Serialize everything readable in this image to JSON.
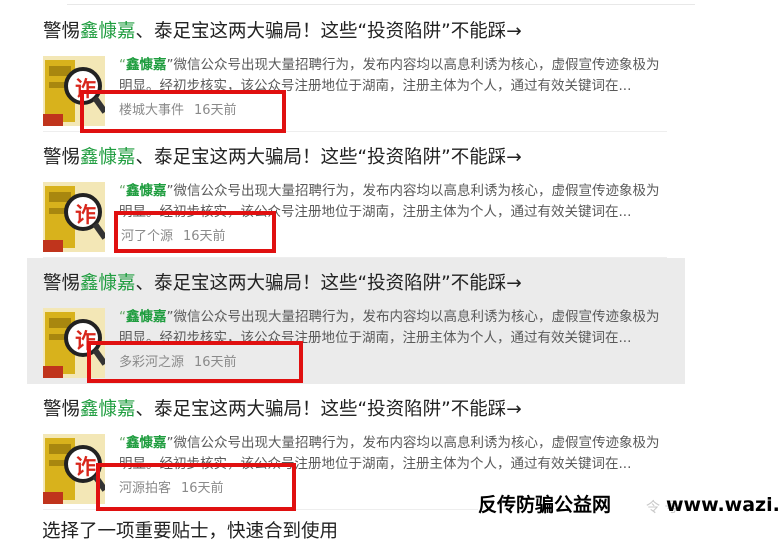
{
  "articles": [
    {
      "title_prefix": "警惕",
      "title_keyword": "鑫慷嘉",
      "title_suffix": "、泰足宝这两大骗局！这些“投资陷阱”不能踩→",
      "snippet_open_quote": "“",
      "snippet_keyword": "鑫慷嘉",
      "snippet_rest": "”微信公众号出现大量招聘行为，发布内容均以高息利诱为核心，虚假宣传迹象极为明显。经初步核实，该公众号注册地位于湖南，注册主体为个人，通过有效关键词在...",
      "source": "楼城大事件",
      "time": "16天前",
      "thumb_icon": "fraud-warning-icon",
      "thumb_glyph": "诈"
    },
    {
      "title_prefix": "警惕",
      "title_keyword": "鑫慷嘉",
      "title_suffix": "、泰足宝这两大骗局！这些“投资陷阱”不能踩→",
      "snippet_open_quote": "“",
      "snippet_keyword": "鑫慷嘉",
      "snippet_rest": "”微信公众号出现大量招聘行为，发布内容均以高息利诱为核心，虚假宣传迹象极为明显。经初步核实，该公众号注册地位于湖南，注册主体为个人，通过有效关键词在...",
      "source": "河了个源",
      "time": "16天前",
      "thumb_icon": "fraud-warning-icon",
      "thumb_glyph": "诈"
    },
    {
      "title_prefix": "警惕",
      "title_keyword": "鑫慷嘉",
      "title_suffix": "、泰足宝这两大骗局！这些“投资陷阱”不能踩→",
      "snippet_open_quote": "“",
      "snippet_keyword": "鑫慷嘉",
      "snippet_rest": "”微信公众号出现大量招聘行为，发布内容均以高息利诱为核心，虚假宣传迹象极为明显。经初步核实，该公众号注册地位于湖南，注册主体为个人，通过有效关键词在...",
      "source": "多彩河之源",
      "time": "16天前",
      "thumb_icon": "fraud-warning-icon",
      "thumb_glyph": "诈"
    },
    {
      "title_prefix": "警惕",
      "title_keyword": "鑫慷嘉",
      "title_suffix": "、泰足宝这两大骗局！这些“投资陷阱”不能踩→",
      "snippet_open_quote": "“",
      "snippet_keyword": "鑫慷嘉",
      "snippet_rest": "”微信公众号出现大量招聘行为，发布内容均以高息利诱为核心，虚假宣传迹象极为明显。经初步核实，该公众号注册地位于湖南，注册主体为个人，通过有效关键词在...",
      "source": "河源拍客",
      "time": "16天前",
      "thumb_icon": "fraud-warning-icon",
      "thumb_glyph": "诈"
    }
  ],
  "next_item_partial_title": "选择了一项重要贴士，快速合到使用",
  "watermark": {
    "site_name": "反传防骗公益网",
    "faint_text": "令 号",
    "url": "www.wazi.cc"
  },
  "colors": {
    "keyword_green": "#1f9d3f",
    "highlight_bg": "#ebebeb",
    "annotation_red": "#e01010",
    "meta_gray": "#8a8a8a"
  }
}
